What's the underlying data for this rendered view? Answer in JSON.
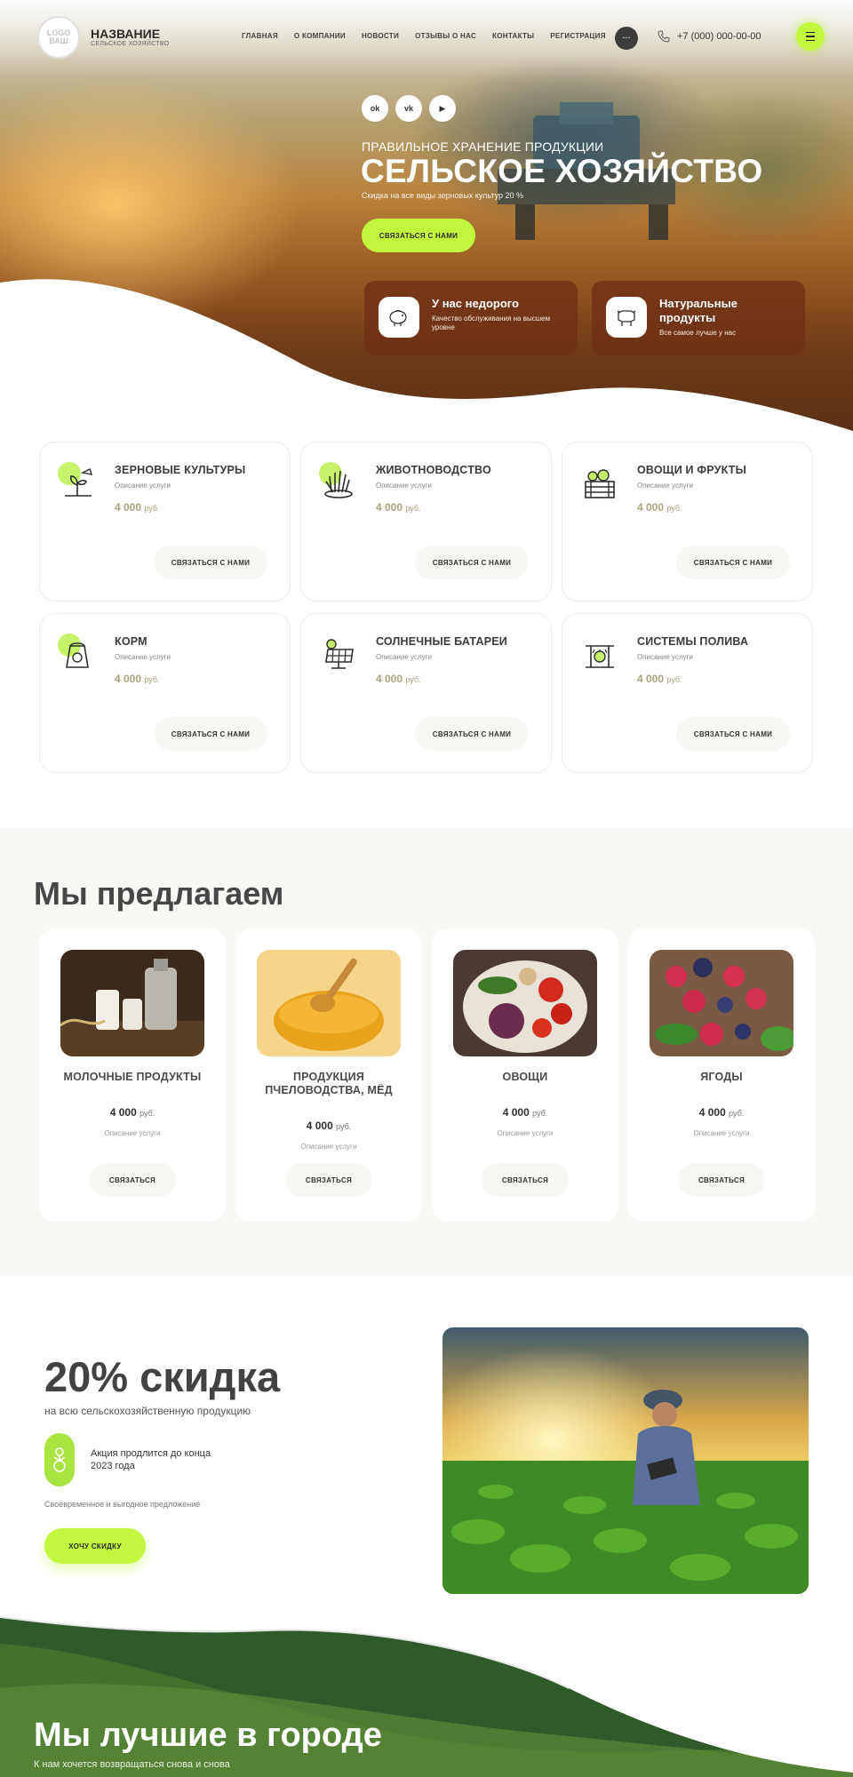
{
  "header": {
    "logo_line1": "LOGO",
    "logo_line2": "ВАШ",
    "brand_name": "НАЗВАНИЕ",
    "brand_sub": "СЕЛЬСКОЕ ХОЗЯЙСТВО",
    "nav": [
      "ГЛАВНАЯ",
      "О КОМПАНИИ",
      "НОВОСТИ",
      "ОТЗЫВЫ О НАС",
      "КОНТАКТЫ",
      "РЕГИСТРАЦИЯ"
    ],
    "more_label": "...",
    "phone": "+7 (000) 000-00-00",
    "accent_color": "#c1f73c"
  },
  "hero": {
    "social": [
      "ok",
      "vk",
      "▶"
    ],
    "kicker": "ПРАВИЛЬНОЕ ХРАНЕНИЕ ПРОДУКЦИИ",
    "title": "СЕЛЬСКОЕ ХОЗЯЙСТВО",
    "subtitle": "Скидка на все виды зерновых культур 20 %",
    "cta": "СВЯЗАТЬСЯ С НАМИ",
    "features": [
      {
        "title": "У нас недорого",
        "desc": "Качество обслуживания на высшем уровне",
        "icon": "piggy-bank-icon"
      },
      {
        "title": "Натуральные продукты",
        "desc": "Все самое лучше у нас",
        "icon": "cow-icon"
      }
    ]
  },
  "services": [
    {
      "name": "ЗЕРНОВЫЕ КУЛЬТУРЫ",
      "desc": "Описание услуги",
      "price": "4 000",
      "currency": "руб.",
      "button": "СВЯЗАТЬСЯ С НАМИ",
      "icon": "watering-plant-icon"
    },
    {
      "name": "ЖИВОТНОВОДСТВО",
      "desc": "Описание услуги",
      "price": "4 000",
      "currency": "руб.",
      "button": "СВЯЗАТЬСЯ С НАМИ",
      "icon": "grass-icon"
    },
    {
      "name": "ОВОЩИ И ФРУКТЫ",
      "desc": "Описание услуги",
      "price": "4 000",
      "currency": "руб.",
      "button": "СВЯЗАТЬСЯ С НАМИ",
      "icon": "crate-icon"
    },
    {
      "name": "КОРМ",
      "desc": "Описание услуги",
      "price": "4 000",
      "currency": "руб.",
      "button": "СВЯЗАТЬСЯ С НАМИ",
      "icon": "feed-bag-icon"
    },
    {
      "name": "СОЛНЕЧНЫЕ БАТАРЕИ",
      "desc": "Описание услуги",
      "price": "4 000",
      "currency": "руб.",
      "button": "СВЯЗАТЬСЯ С НАМИ",
      "icon": "solar-panel-icon"
    },
    {
      "name": "СИСТЕМЫ ПОЛИВА",
      "desc": "Описание услуги",
      "price": "4 000",
      "currency": "руб.",
      "button": "СВЯЗАТЬСЯ С НАМИ",
      "icon": "irrigation-icon"
    }
  ],
  "offers": {
    "title": "Мы предлагаем",
    "items": [
      {
        "name": "МОЛОЧНЫЕ ПРОДУКТЫ",
        "price": "4 000",
        "currency": "руб.",
        "desc": "Описание услуги",
        "button": "СВЯЗАТЬСЯ",
        "image": "milk-image"
      },
      {
        "name": "ПРОДУКЦИЯ ПЧЕЛОВОДСТВА, МЁД",
        "price": "4 000",
        "currency": "руб.",
        "desc": "Описание услуги",
        "button": "СВЯЗАТЬСЯ",
        "image": "honey-image"
      },
      {
        "name": "ОВОЩИ",
        "price": "4 000",
        "currency": "руб.",
        "desc": "Описание услуги",
        "button": "СВЯЗАТЬСЯ",
        "image": "vegetables-image"
      },
      {
        "name": "ЯГОДЫ",
        "price": "4 000",
        "currency": "руб.",
        "desc": "Описание услуги",
        "button": "СВЯЗАТЬСЯ",
        "image": "berries-image"
      }
    ]
  },
  "discount": {
    "title": "20% скидка",
    "subtitle": "на всю сельскохозяйственную продукцию",
    "note": "Акция продлится до конца 2023 года",
    "small": "Своевременное и выгодное предложение",
    "button": "ХОЧУ СКИДКУ"
  },
  "bottom": {
    "title": "Мы лучшие в городе",
    "subtitle": "К нам хочется возвращаться снова и снова"
  }
}
